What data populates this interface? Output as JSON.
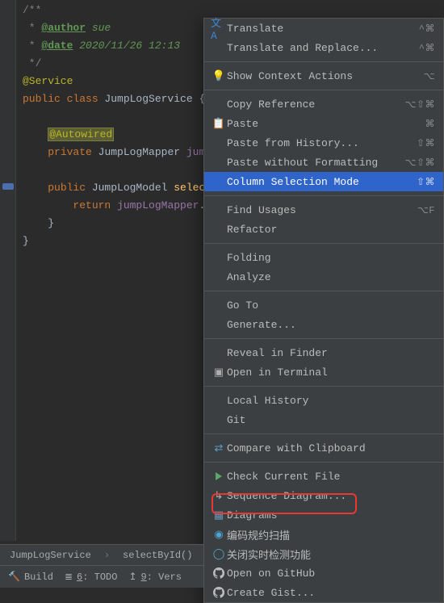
{
  "code": {
    "l1": "/**",
    "l2a": " * ",
    "l2b": "@author",
    "l2c": " sue",
    "l3a": " * ",
    "l3b": "@date",
    "l3c": " 2020/11/26 12:13",
    "l4": " */",
    "l5": "@Service",
    "l6a": "public class ",
    "l6b": "JumpLogService ",
    "l6c": "{",
    "l8a": "    ",
    "l8b": "@Autowired",
    "l9a": "    ",
    "l9b": "private ",
    "l9c": "JumpLogMapper ",
    "l9d": "jum",
    "l11a": "    ",
    "l11b": "public ",
    "l11c": "JumpLogModel ",
    "l11d": "selec",
    "l12a": "        ",
    "l12b": "return ",
    "l12c": "jumpLogMapper",
    "l12d": ".",
    "l13": "    }",
    "l14": "}"
  },
  "menu": {
    "translate": "Translate",
    "translate_sc": "^⌘",
    "translate_replace": "Translate and Replace...",
    "translate_replace_sc": "^⌘",
    "show_context": "Show Context Actions",
    "show_context_sc": "⌥",
    "copy_ref": "Copy Reference",
    "copy_ref_sc": "⌥⇧⌘",
    "paste": "Paste",
    "paste_sc": "⌘",
    "paste_hist": "Paste from History...",
    "paste_hist_sc": "⇧⌘",
    "paste_nf": "Paste without Formatting",
    "paste_nf_sc": "⌥⇧⌘",
    "col_sel": "Column Selection Mode",
    "col_sel_sc": "⇧⌘",
    "find_usages": "Find Usages",
    "find_usages_sc": "⌥F",
    "refactor": "Refactor",
    "folding": "Folding",
    "analyze": "Analyze",
    "goto": "Go To",
    "generate": "Generate...",
    "reveal": "Reveal in Finder",
    "terminal": "Open in Terminal",
    "local_hist": "Local History",
    "git": "Git",
    "compare": "Compare with Clipboard",
    "check": "Check Current File",
    "seq": "Sequence Diagram...",
    "diagrams": "Diagrams",
    "scan": "编码规约扫描",
    "realtime": "关闭实时检测功能",
    "github": "Open on GitHub",
    "gist": "Create Gist..."
  },
  "breadcrumb": {
    "a": "JumpLogService",
    "b": "selectById()"
  },
  "toolbar": {
    "build": "Build",
    "todo": "6: TODO",
    "todo_u": "6",
    "vers": "9: Vers",
    "vers_u": "9"
  }
}
